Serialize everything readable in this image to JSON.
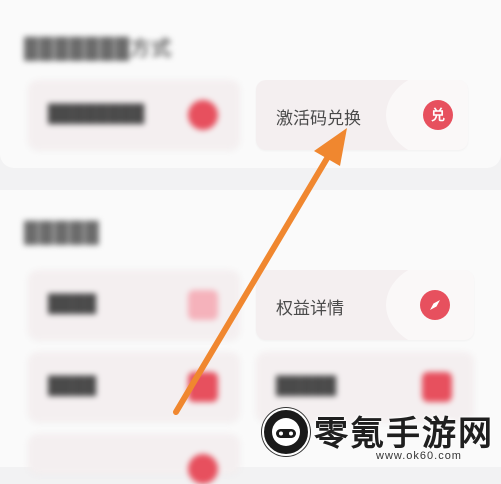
{
  "section1": {
    "title": "███████方式",
    "cards": [
      {
        "label": "████████",
        "icon": "gift-icon"
      },
      {
        "label": "激活码兑换",
        "icon": "redeem-icon",
        "icon_text": "兑"
      }
    ]
  },
  "section2": {
    "title": "█████",
    "cards": [
      {
        "label": "████",
        "icon": "square-icon"
      },
      {
        "label": "权益详情",
        "icon": "compass-icon"
      },
      {
        "label": "████",
        "icon": "square-icon"
      },
      {
        "label": "█████",
        "icon": "square-icon"
      }
    ]
  },
  "watermark": {
    "title": "零氪手游网",
    "url": "www.ok60.com"
  },
  "colors": {
    "accent_red": "#e7505e",
    "arrow_orange": "#f0872f"
  }
}
